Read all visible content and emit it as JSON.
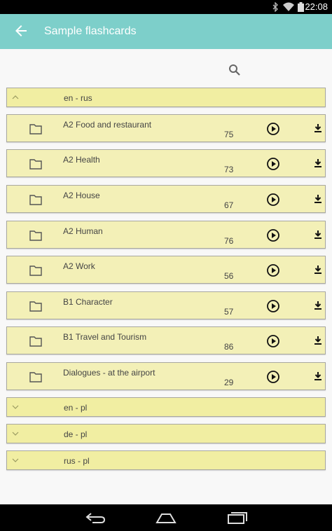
{
  "status": {
    "time": "22:08",
    "icons": [
      "bluetooth-icon",
      "wifi-icon",
      "battery-icon"
    ]
  },
  "appbar": {
    "title": "Sample flashcards",
    "back_icon": "arrow-back-icon",
    "color": "#7dcfca"
  },
  "search": {
    "icon": "search-icon"
  },
  "groups": [
    {
      "label": "en - rus",
      "expanded": true,
      "decks": [
        {
          "name": "A2 Food and restaurant",
          "count": "75"
        },
        {
          "name": "A2 Health",
          "count": "73"
        },
        {
          "name": "A2 House",
          "count": "67"
        },
        {
          "name": "A2 Human",
          "count": "76"
        },
        {
          "name": "A2 Work",
          "count": "56"
        },
        {
          "name": "B1 Character",
          "count": "57"
        },
        {
          "name": "B1 Travel and Tourism",
          "count": "86"
        },
        {
          "name": "Dialogues - at the airport",
          "count": "29"
        }
      ]
    },
    {
      "label": "en - pl",
      "expanded": false
    },
    {
      "label": "de - pl",
      "expanded": false
    },
    {
      "label": "rus - pl",
      "expanded": false
    }
  ],
  "navbar": {
    "icons": [
      "back-nav-icon",
      "home-nav-icon",
      "recents-nav-icon"
    ]
  }
}
